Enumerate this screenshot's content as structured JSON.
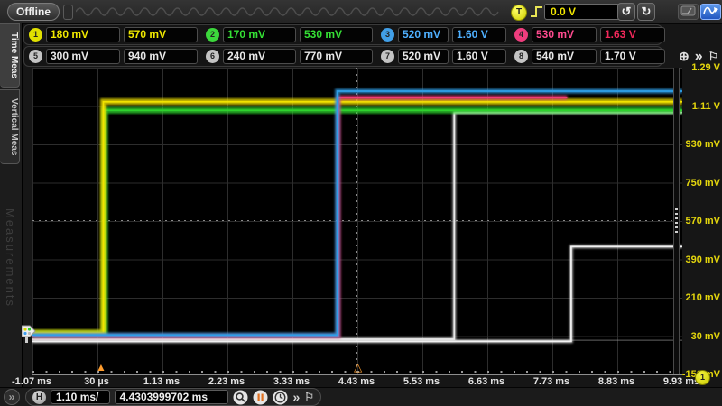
{
  "app": {
    "status_label": "Offline",
    "trigger": {
      "badge": "T",
      "edge": "rising",
      "level": "0.0 V"
    },
    "icons": {
      "undo": "↺",
      "redo": "↻",
      "add": "⊕",
      "more": "»",
      "pin": "⚐",
      "trigger_marker": "▲",
      "reference_marker": "△"
    }
  },
  "sidebar": {
    "tabs": [
      {
        "label": "Time Meas"
      },
      {
        "label": "Vertical Meas"
      }
    ],
    "watermark": "Measurements"
  },
  "measurements": {
    "rows": [
      {
        "groups": [
          {
            "ch": "1",
            "badge_color": "#e0e000",
            "value_colors": [
              "#f0e800",
              "#f0e800"
            ],
            "values": [
              "180 mV",
              "570 mV"
            ]
          },
          {
            "ch": "2",
            "badge_color": "#3cd83c",
            "value_colors": [
              "#35e035",
              "#35e035"
            ],
            "values": [
              "170 mV",
              "530 mV"
            ]
          },
          {
            "ch": "3",
            "badge_color": "#419fe8",
            "value_colors": [
              "#4fb0ff",
              "#4fb0ff"
            ],
            "values": [
              "520 mV",
              "1.60 V"
            ]
          },
          {
            "ch": "4",
            "badge_color": "#ee3d7d",
            "value_colors": [
              "#ff4b8f",
              "#f2285a"
            ],
            "values": [
              "530 mV",
              "1.63 V"
            ]
          }
        ],
        "trailing": false
      },
      {
        "groups": [
          {
            "ch": "5",
            "badge_color": "#c4c4c4",
            "value_colors": [
              "#e8e8e8",
              "#e8e8e8"
            ],
            "values": [
              "300 mV",
              "940 mV"
            ]
          },
          {
            "ch": "6",
            "badge_color": "#c4c4c4",
            "value_colors": [
              "#e8e8e8",
              "#e8e8e8"
            ],
            "values": [
              "240 mV",
              "770 mV"
            ]
          },
          {
            "ch": "7",
            "badge_color": "#c4c4c4",
            "value_colors": [
              "#e8e8e8",
              "#e8e8e8"
            ],
            "values": [
              "520 mV",
              "1.60 V"
            ]
          },
          {
            "ch": "8",
            "badge_color": "#c4c4c4",
            "value_colors": [
              "#e8e8e8",
              "#e8e8e8"
            ],
            "values": [
              "540 mV",
              "1.70 V"
            ]
          }
        ],
        "trailing": true
      }
    ]
  },
  "chart": {
    "x_labels": [
      "-1.07 ms",
      "30 µs",
      "1.13 ms",
      "2.23 ms",
      "3.33 ms",
      "4.43 ms",
      "5.53 ms",
      "6.63 ms",
      "7.73 ms",
      "8.83 ms",
      "9.93 ms"
    ],
    "y_labels": [
      "1.29 V",
      "1.11 V",
      "930 mV",
      "750 mV",
      "570 mV",
      "390 mV",
      "210 mV",
      "30 mV",
      "-150 mV"
    ],
    "channel_badge": "1"
  },
  "footer": {
    "h_badge": "H",
    "timebase": "1.10 ms/",
    "delay": "4.4303999702 ms"
  },
  "chart_data": {
    "type": "line",
    "x_unit": "ms",
    "x_range_ms": [
      -1.07,
      9.93
    ],
    "y_range_V": [
      -0.15,
      1.29
    ],
    "draw_order": [
      "baseline-noise",
      "channel-white-b",
      "channel-white-a",
      "channel-2",
      "channel-1",
      "channel-4",
      "channel-3"
    ],
    "series": [
      {
        "name": "channel-1",
        "color": "#f2e300",
        "low_V": 0.045,
        "high_V": 1.13,
        "rise_ms": 0.13
      },
      {
        "name": "channel-2",
        "color": "#2ed32e",
        "low_V": 0.04,
        "high_V": 1.09,
        "rise_ms": 0.15
      },
      {
        "name": "channel-3",
        "color": "#2f9fe8",
        "low_V": 0.035,
        "high_V": 1.18,
        "rise_ms": 4.09
      },
      {
        "name": "channel-4",
        "color": "#f23c78",
        "low_V": 0.03,
        "high_V": 1.15,
        "rise_ms": 4.11,
        "visible_until_ms": 7.98
      },
      {
        "name": "channel-white-a",
        "color": "#e8e8e8",
        "low_V": 0.015,
        "high_V": 1.08,
        "rise_ms": 6.07
      },
      {
        "name": "channel-white-b",
        "color": "#f2f2f2",
        "low_V": 0.005,
        "high_V": 0.45,
        "rise_ms": 8.05
      },
      {
        "name": "baseline-noise",
        "color": "#9a9a9a",
        "low_V": 0.01,
        "high_V": 0.01,
        "rise_ms": 99
      }
    ]
  }
}
